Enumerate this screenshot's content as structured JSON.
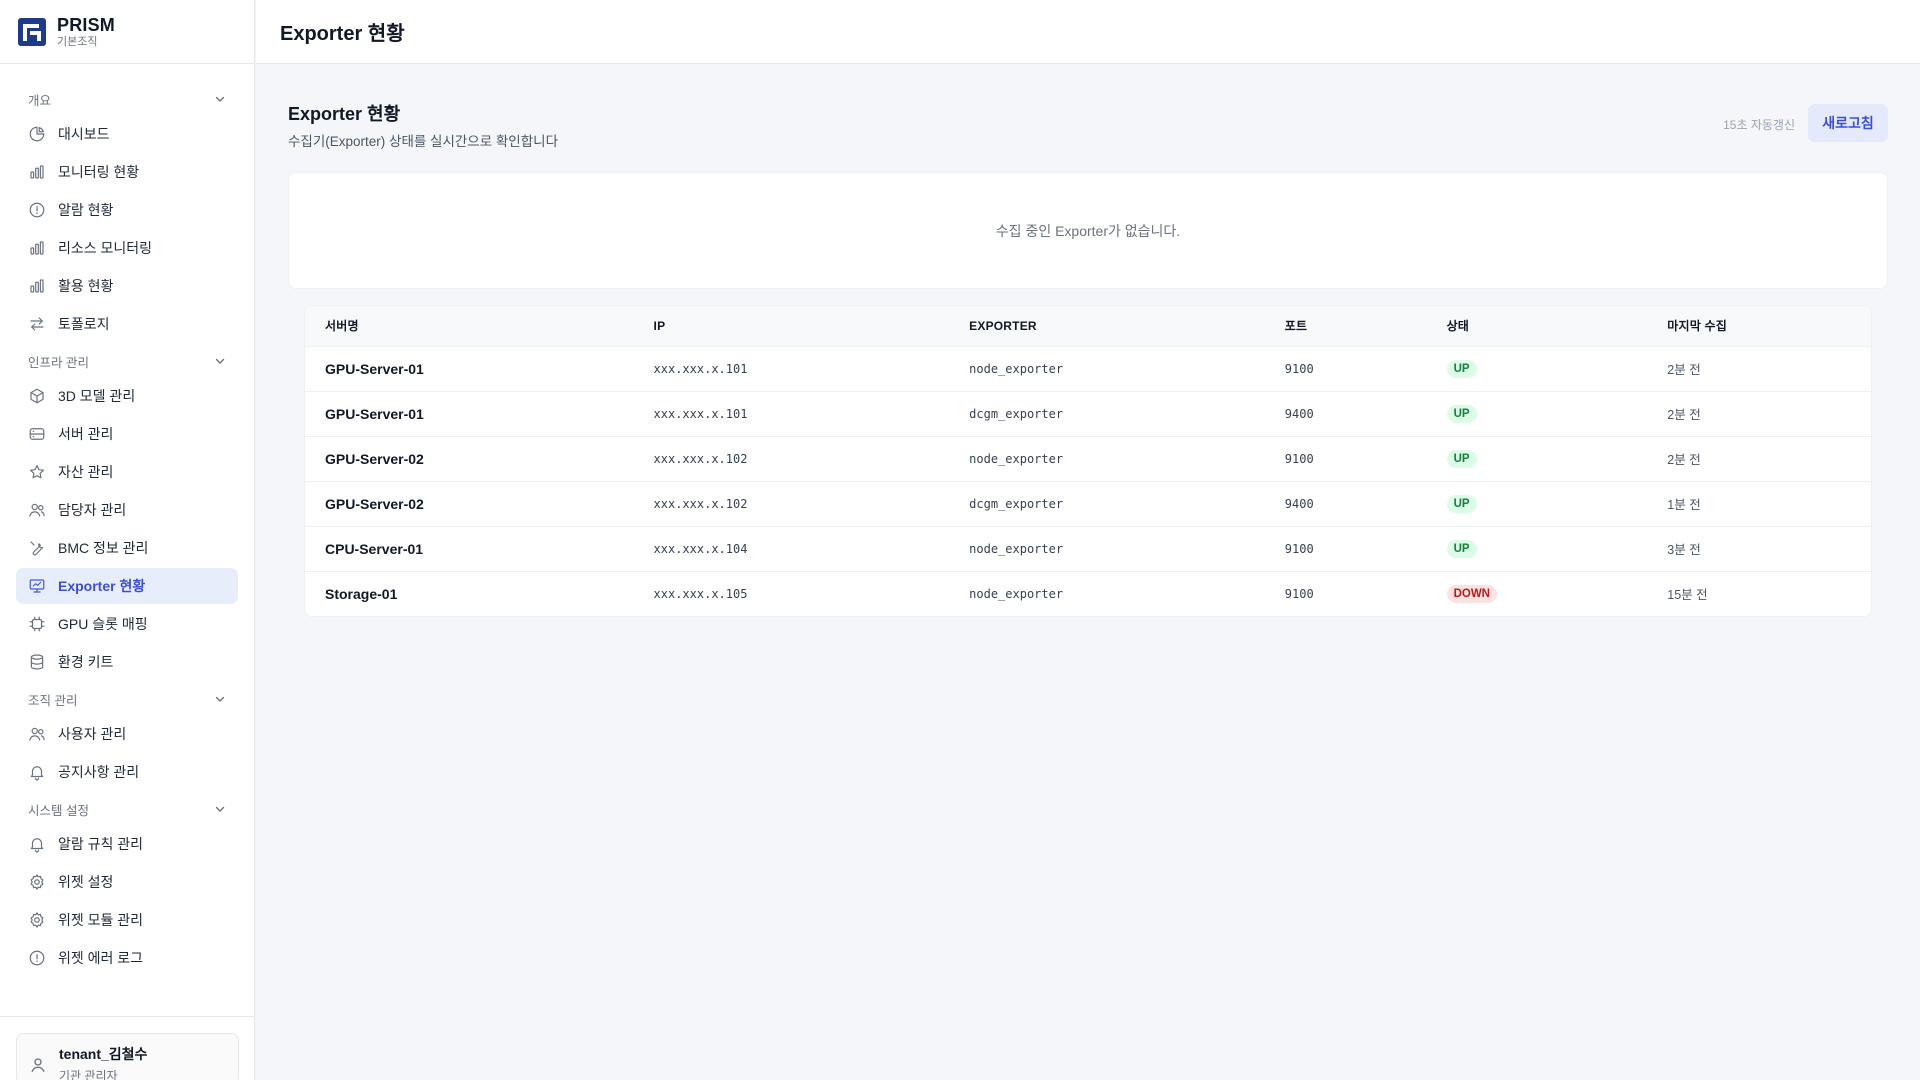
{
  "brand": {
    "name": "PRISM",
    "sub": "기본조직"
  },
  "topbar": {
    "title": "Exporter 현황"
  },
  "sidebar": {
    "groups": [
      {
        "label": "개요",
        "items": [
          {
            "label": "대시보드",
            "icon": "pie-chart-icon"
          },
          {
            "label": "모니터링 현황",
            "icon": "bar-chart-icon"
          },
          {
            "label": "알람 현황",
            "icon": "alert-circle-icon"
          },
          {
            "label": "리소스 모니터링",
            "icon": "bar-chart-icon"
          },
          {
            "label": "활용 현황",
            "icon": "bar-chart-icon"
          },
          {
            "label": "토폴로지",
            "icon": "arrows-swap-icon"
          }
        ]
      },
      {
        "label": "인프라 관리",
        "items": [
          {
            "label": "3D 모델 관리",
            "icon": "cube-icon"
          },
          {
            "label": "서버 관리",
            "icon": "server-icon"
          },
          {
            "label": "자산 관리",
            "icon": "star-icon"
          },
          {
            "label": "담당자 관리",
            "icon": "users-icon"
          },
          {
            "label": "BMC 정보 관리",
            "icon": "wrench-icon"
          },
          {
            "label": "Exporter 현황",
            "icon": "presentation-icon",
            "active": true
          },
          {
            "label": "GPU 슬롯 매핑",
            "icon": "chip-icon"
          },
          {
            "label": "환경 키트",
            "icon": "database-icon"
          }
        ]
      },
      {
        "label": "조직 관리",
        "items": [
          {
            "label": "사용자 관리",
            "icon": "users-icon"
          },
          {
            "label": "공지사항 관리",
            "icon": "bell-icon"
          }
        ]
      },
      {
        "label": "시스템 설정",
        "items": [
          {
            "label": "알람 규칙 관리",
            "icon": "bell-icon"
          },
          {
            "label": "위젯 설정",
            "icon": "gear-icon"
          },
          {
            "label": "위젯 모듈 관리",
            "icon": "gear-icon"
          },
          {
            "label": "위젯 에러 로그",
            "icon": "alert-circle-icon"
          }
        ]
      }
    ]
  },
  "user": {
    "name": "tenant_김철수",
    "role": "기관 관리자"
  },
  "main": {
    "title": "Exporter 현황",
    "subtitle": "수집기(Exporter) 상태를 실시간으로 확인합니다",
    "auto_refresh": "15초 자동갱신",
    "refresh_label": "새로고침",
    "empty_message": "수집 중인 Exporter가 없습니다."
  },
  "table": {
    "columns": [
      "서버명",
      "IP",
      "EXPORTER",
      "포트",
      "상태",
      "마지막 수집"
    ],
    "rows": [
      {
        "server": "GPU-Server-01",
        "ip": "xxx.xxx.x.101",
        "exporter": "node_exporter",
        "port": "9100",
        "status": "UP",
        "last": "2분 전"
      },
      {
        "server": "GPU-Server-01",
        "ip": "xxx.xxx.x.101",
        "exporter": "dcgm_exporter",
        "port": "9400",
        "status": "UP",
        "last": "2분 전"
      },
      {
        "server": "GPU-Server-02",
        "ip": "xxx.xxx.x.102",
        "exporter": "node_exporter",
        "port": "9100",
        "status": "UP",
        "last": "2분 전"
      },
      {
        "server": "GPU-Server-02",
        "ip": "xxx.xxx.x.102",
        "exporter": "dcgm_exporter",
        "port": "9400",
        "status": "UP",
        "last": "1분 전"
      },
      {
        "server": "CPU-Server-01",
        "ip": "xxx.xxx.x.104",
        "exporter": "node_exporter",
        "port": "9100",
        "status": "UP",
        "last": "3분 전"
      },
      {
        "server": "Storage-01",
        "ip": "xxx.xxx.x.105",
        "exporter": "node_exporter",
        "port": "9100",
        "status": "DOWN",
        "last": "15분 전"
      }
    ]
  },
  "colors": {
    "accent": "#3b4fd8",
    "active_bg": "#e8edfb",
    "up": "#15803d",
    "down": "#b91c1c",
    "brand": "#1e3a8a"
  }
}
